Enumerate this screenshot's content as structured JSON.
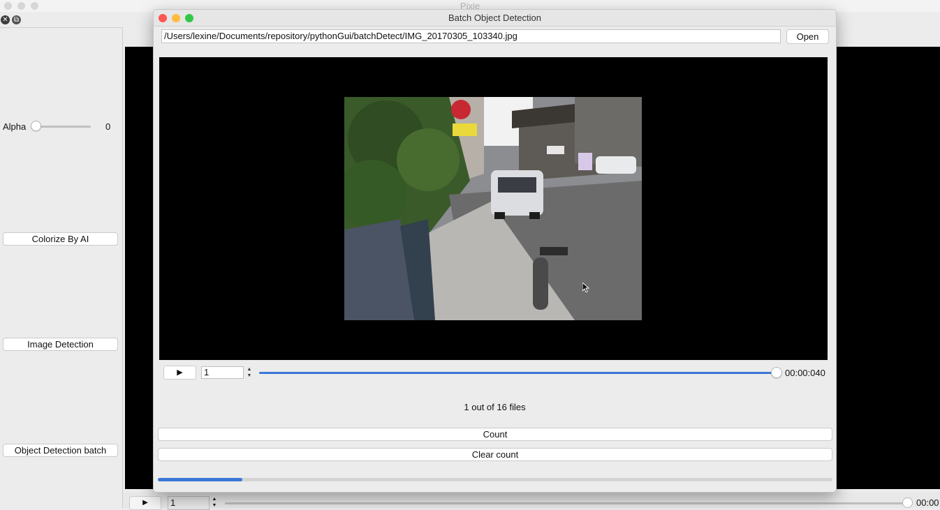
{
  "app": {
    "title": "Pixie"
  },
  "sidebar": {
    "alpha_label": "Alpha",
    "alpha_value": "0",
    "alpha_level": 0,
    "colorize_label": "Colorize By AI",
    "image_detection_label": "Image Detection",
    "object_detection_batch_label": "Object Detection batch"
  },
  "bottom_bar": {
    "frame_value": "1",
    "time": "00:00"
  },
  "dialog": {
    "title": "Batch Object Detection",
    "file_path": "/Users/lexine/Documents/repository/pythonGui/batchDetect/IMG_20170305_103340.jpg",
    "open_label": "Open",
    "frame_value": "1",
    "slider_level": 1.0,
    "time": "00:00:040",
    "status": "1 out of 16 files",
    "count_label": "Count",
    "clear_count_label": "Clear count",
    "progress_level": 0.125
  },
  "colors": {
    "accent": "#3a78d8",
    "close": "#fc5753",
    "minimize": "#fdbc40",
    "zoom": "#33c748"
  }
}
